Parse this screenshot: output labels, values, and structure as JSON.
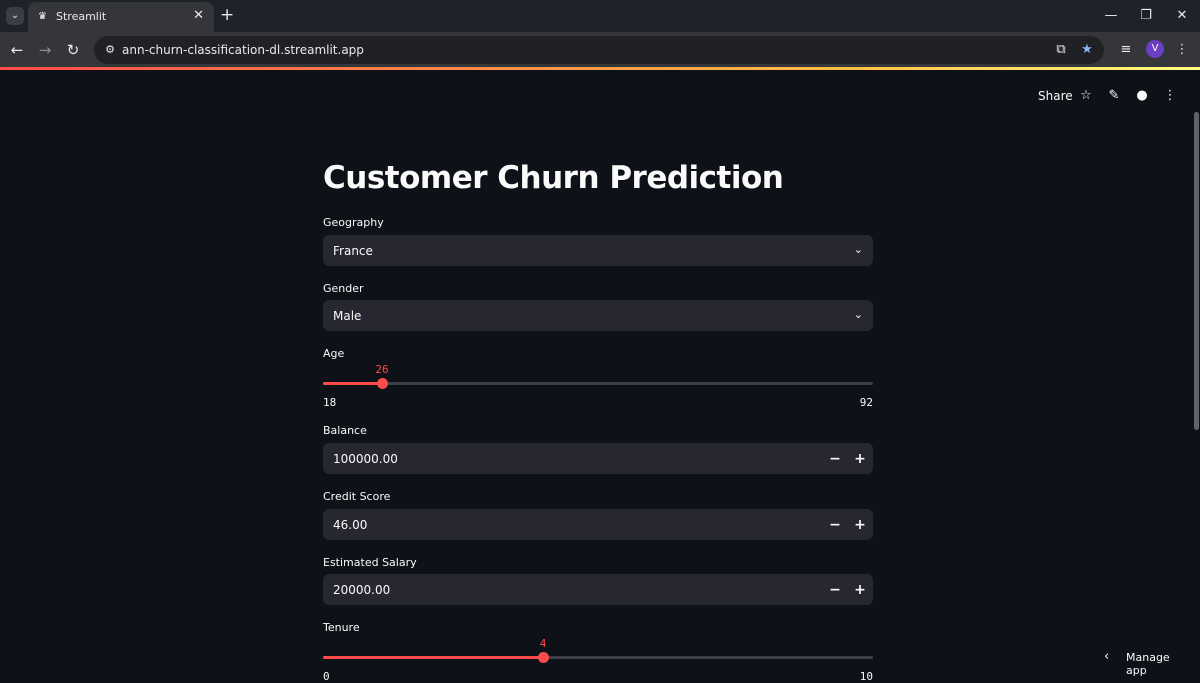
{
  "browser": {
    "tab_title": "Streamlit",
    "url": "ann-churn-classification-dl.streamlit.app",
    "profile_initial": "V"
  },
  "header": {
    "share_label": "Share"
  },
  "page": {
    "title": "Customer Churn Prediction"
  },
  "form": {
    "geography": {
      "label": "Geography",
      "value": "France"
    },
    "gender": {
      "label": "Gender",
      "value": "Male"
    },
    "age": {
      "label": "Age",
      "value": "26",
      "min": "18",
      "max": "92",
      "level": 26
    },
    "balance": {
      "label": "Balance",
      "value": "100000.00"
    },
    "credit_score": {
      "label": "Credit Score",
      "value": "46.00"
    },
    "estimated_salary": {
      "label": "Estimated Salary",
      "value": "20000.00"
    },
    "tenure": {
      "label": "Tenure",
      "value": "4",
      "min": "0",
      "max": "10",
      "level": 4
    }
  },
  "stepper": {
    "minus": "−",
    "plus": "+"
  },
  "footer": {
    "manage_label": "Manage app"
  },
  "colors": {
    "accent": "#ff4b4b",
    "background": "#0e1117",
    "input": "#262730"
  },
  "icons": [
    "search-tabs-icon",
    "streamlit-favicon-icon",
    "close-icon",
    "new-tab-icon",
    "minimize-icon",
    "restore-icon",
    "window-close-icon",
    "back-icon",
    "forward-icon",
    "reload-icon",
    "site-settings-icon",
    "install-app-icon",
    "bookmark-star-icon",
    "media-icon",
    "menu-icon",
    "star-icon",
    "edit-icon",
    "github-icon",
    "chevron-down-icon",
    "chevron-left-icon"
  ]
}
